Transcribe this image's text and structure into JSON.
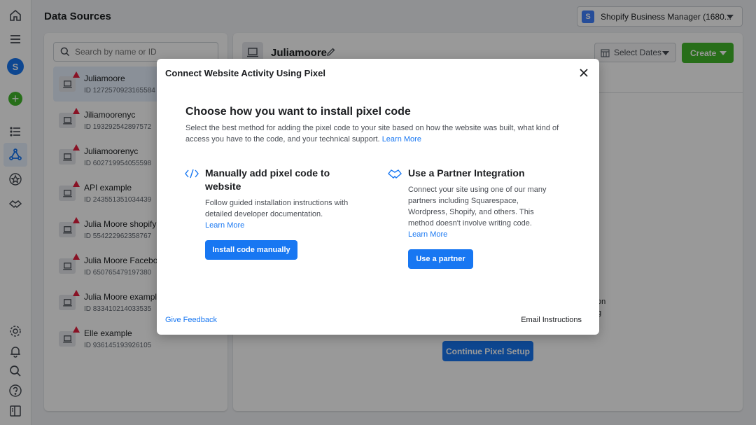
{
  "header": {
    "title": "Data Sources",
    "business_manager": "Shopify Business Manager (1680...",
    "bm_initial": "S"
  },
  "rail": {
    "avatar_initial": "S"
  },
  "search": {
    "placeholder": "Search by name or ID"
  },
  "sources": [
    {
      "name": "Juliamoore",
      "id": "ID 1272570923165584",
      "selected": true
    },
    {
      "name": "Jiliamoorenyc",
      "id": "ID 193292542897572"
    },
    {
      "name": "Juliamoorenyc",
      "id": "ID 602719954055598"
    },
    {
      "name": "API example",
      "id": "ID 243551351034439"
    },
    {
      "name": "Julia Moore shopify s",
      "id": "ID 554222962358767"
    },
    {
      "name": "Julia Moore Faceboo",
      "id": "ID 650765479197380"
    },
    {
      "name": "Julia Moore example",
      "id": "ID 833410214033535"
    },
    {
      "name": "Elle example",
      "id": "ID 936145193926105"
    }
  ],
  "main": {
    "title": "Juliamoore",
    "select_dates": "Select Dates",
    "create": "Create",
    "continue_setup": "Continue Pixel Setup",
    "bg_fragment_1": "on",
    "bg_fragment_2": "g"
  },
  "modal": {
    "header": "Connect Website Activity Using Pixel",
    "heading": "Choose how you want to install pixel code",
    "description": "Select the best method for adding the pixel code to your site based on how the website was built, what kind of access you have to the code, and your technical support.",
    "learn_more": "Learn More",
    "manual": {
      "title": "Manually add pixel code to website",
      "description": "Follow guided installation instructions with detailed developer documentation.",
      "learn_more": "Learn More",
      "button": "Install code manually"
    },
    "partner": {
      "title": "Use a Partner Integration",
      "description": "Connect your site using one of our many partners including Squarespace, Wordpress, Shopify, and others. This method doesn't involve writing code.",
      "learn_more": "Learn More",
      "button": "Use a partner"
    },
    "give_feedback": "Give Feedback",
    "email_instructions": "Email Instructions"
  },
  "colors": {
    "accent": "#1877f2",
    "create_green": "#42b72a",
    "warning": "#e41e3f"
  }
}
